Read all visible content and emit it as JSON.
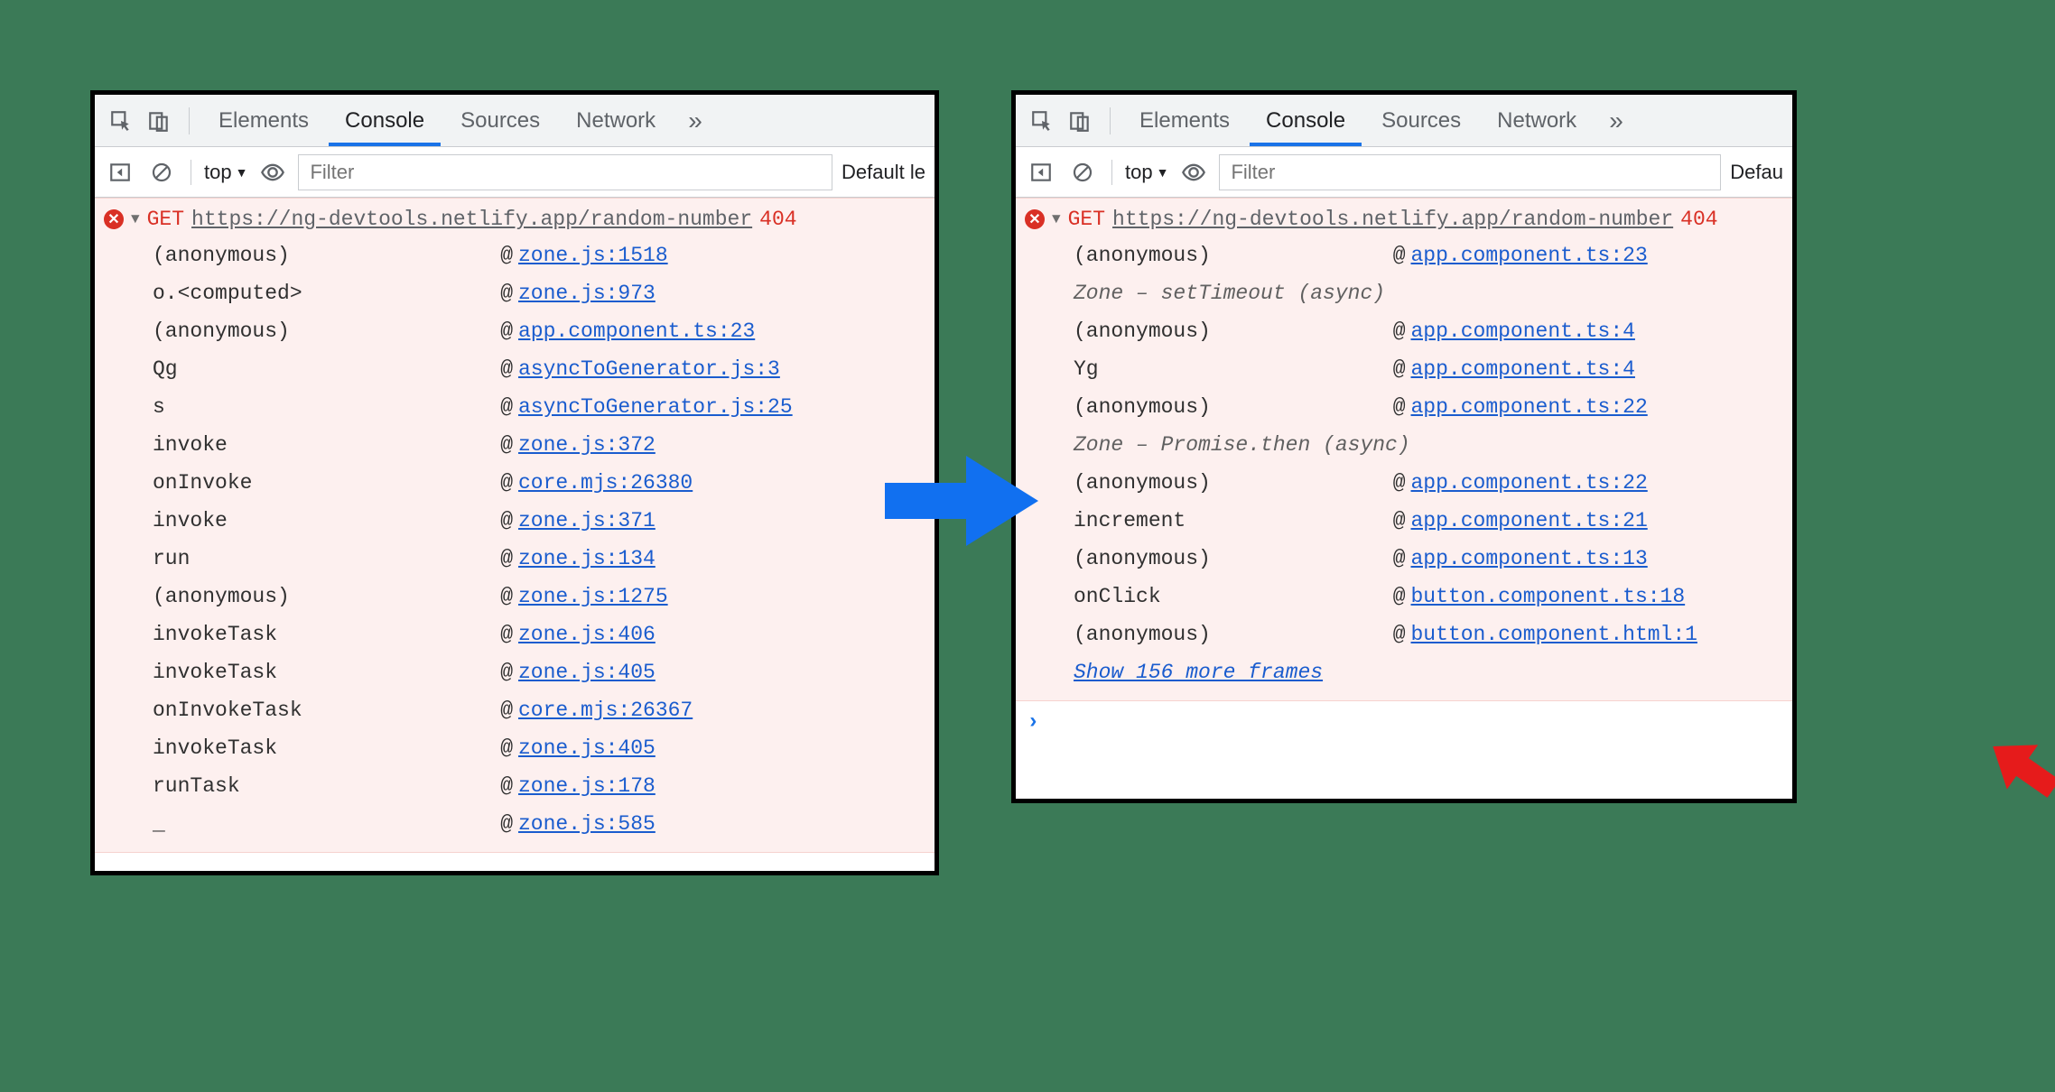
{
  "tabs": {
    "elements": "Elements",
    "console": "Console",
    "sources": "Sources",
    "network": "Network"
  },
  "filterbar": {
    "context": "top",
    "filter_placeholder": "Filter",
    "levels_left": "Default le",
    "levels_right": "Defau"
  },
  "error": {
    "method": "GET",
    "url": "https://ng-devtools.netlify.app/random-number",
    "status": "404"
  },
  "left_frames": [
    {
      "fn": "(anonymous)",
      "link": "zone.js:1518"
    },
    {
      "fn": "o.<computed>",
      "link": "zone.js:973"
    },
    {
      "fn": "(anonymous)",
      "link": "app.component.ts:23"
    },
    {
      "fn": "Qg",
      "link": "asyncToGenerator.js:3"
    },
    {
      "fn": "s",
      "link": "asyncToGenerator.js:25"
    },
    {
      "fn": "invoke",
      "link": "zone.js:372"
    },
    {
      "fn": "onInvoke",
      "link": "core.mjs:26380"
    },
    {
      "fn": "invoke",
      "link": "zone.js:371"
    },
    {
      "fn": "run",
      "link": "zone.js:134"
    },
    {
      "fn": "(anonymous)",
      "link": "zone.js:1275"
    },
    {
      "fn": "invokeTask",
      "link": "zone.js:406"
    },
    {
      "fn": "invokeTask",
      "link": "zone.js:405"
    },
    {
      "fn": "onInvokeTask",
      "link": "core.mjs:26367"
    },
    {
      "fn": "invokeTask",
      "link": "zone.js:405"
    },
    {
      "fn": "runTask",
      "link": "zone.js:178"
    },
    {
      "fn": "_",
      "link": "zone.js:585"
    }
  ],
  "right_frames": [
    {
      "fn": "(anonymous)",
      "link": "app.component.ts:23"
    },
    {
      "async": "Zone – setTimeout (async)"
    },
    {
      "fn": "(anonymous)",
      "link": "app.component.ts:4"
    },
    {
      "fn": "Yg",
      "link": "app.component.ts:4"
    },
    {
      "fn": "(anonymous)",
      "link": "app.component.ts:22"
    },
    {
      "async": "Zone – Promise.then (async)"
    },
    {
      "fn": "(anonymous)",
      "link": "app.component.ts:22"
    },
    {
      "fn": "increment",
      "link": "app.component.ts:21"
    },
    {
      "fn": "(anonymous)",
      "link": "app.component.ts:13"
    },
    {
      "fn": "onClick",
      "link": "button.component.ts:18"
    },
    {
      "fn": "(anonymous)",
      "link": "button.component.html:1"
    }
  ],
  "show_more": "Show 156 more frames"
}
